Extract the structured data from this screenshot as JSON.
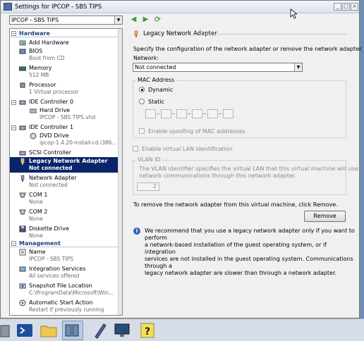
{
  "window": {
    "title": "Settings for IPCOP - SBS TIPS"
  },
  "vm_selector": {
    "value": "IPCOP - SBS TIPS"
  },
  "tree": {
    "hardware_label": "Hardware",
    "items": [
      {
        "name": "Add Hardware",
        "sub": ""
      },
      {
        "name": "BIOS",
        "sub": "Boot from CD"
      },
      {
        "name": "Memory",
        "sub": "512 MB"
      },
      {
        "name": "Processor",
        "sub": "1 Virtual processor"
      },
      {
        "name": "IDE Controller 0",
        "sub": ""
      },
      {
        "name": "Hard Drive",
        "sub": "IPCOP - SBS TIPS.vhd"
      },
      {
        "name": "IDE Controller 1",
        "sub": ""
      },
      {
        "name": "DVD Drive",
        "sub": "ipcop-1.4.20-install-cd.i386..."
      },
      {
        "name": "SCSI Controller",
        "sub": ""
      },
      {
        "name": "Legacy Network Adapter",
        "sub": "Not connected"
      },
      {
        "name": "Network Adapter",
        "sub": "Not connected"
      },
      {
        "name": "COM 1",
        "sub": "None"
      },
      {
        "name": "COM 2",
        "sub": "None"
      },
      {
        "name": "Diskette Drive",
        "sub": "None"
      }
    ],
    "management_label": "Management",
    "mgmt_items": [
      {
        "name": "Name",
        "sub": "IPCOP - SBS TIPS"
      },
      {
        "name": "Integration Services",
        "sub": "All services offered"
      },
      {
        "name": "Snapshot File Location",
        "sub": "C:\\ProgramData\\Microsoft\\Win..."
      },
      {
        "name": "Automatic Start Action",
        "sub": "Restart if previously running"
      }
    ]
  },
  "panel": {
    "header": "Legacy Network Adapter",
    "description": "Specify the configuration of the network adapter or remove the network adapter.",
    "network_label": "Network:",
    "network_value": "Not connected",
    "mac_group": "MAC Address",
    "dynamic_label": "Dynamic",
    "static_label": "Static",
    "spoofing_label": "Enable spoofing of MAC addresses",
    "vlan_enable_label": "Enable virtual LAN identification",
    "vlan_group": "VLAN ID",
    "vlan_desc_1": "The VLAN identifier specifies the virtual LAN that this virtual machine will use for all",
    "vlan_desc_2": "network communications through this network adapter.",
    "vlan_value": "2",
    "remove_text": "To remove the network adapter from this virtual machine, click Remove.",
    "remove_button": "Remove",
    "info_1": "We recommend that you use a legacy network adapter only if you want to perform",
    "info_2": "a network-based installation of the guest operating system, or if integration",
    "info_3": "services are not installed in the guest operating system. Communications through a",
    "info_4": "legacy network adapter are slower than through a network adapter."
  },
  "colors": {
    "selection": "#0a246a",
    "section_text": "#1a3f7a",
    "info": "#2a62c9"
  }
}
